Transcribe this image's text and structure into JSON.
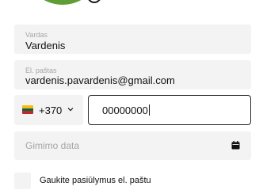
{
  "form": {
    "name": {
      "label": "Vardas",
      "value": "Vardenis"
    },
    "email": {
      "label": "El. paštas",
      "value": "vardenis.pavardenis@gmail.com"
    },
    "phone": {
      "country_flag": "lithuania-flag-icon",
      "dial_code": "+370",
      "number": "00000000"
    },
    "birthdate": {
      "placeholder": "Gimimo data",
      "icon": "calendar-icon"
    },
    "offers_checkbox": {
      "label": "Gaukite pasiūlymus el. paštu",
      "checked": false
    }
  },
  "colors": {
    "avatar": "#5f9d35",
    "field_background": "#f3f3f3",
    "label_text": "#a5a5a5",
    "active_border": "#2a2a2a"
  }
}
